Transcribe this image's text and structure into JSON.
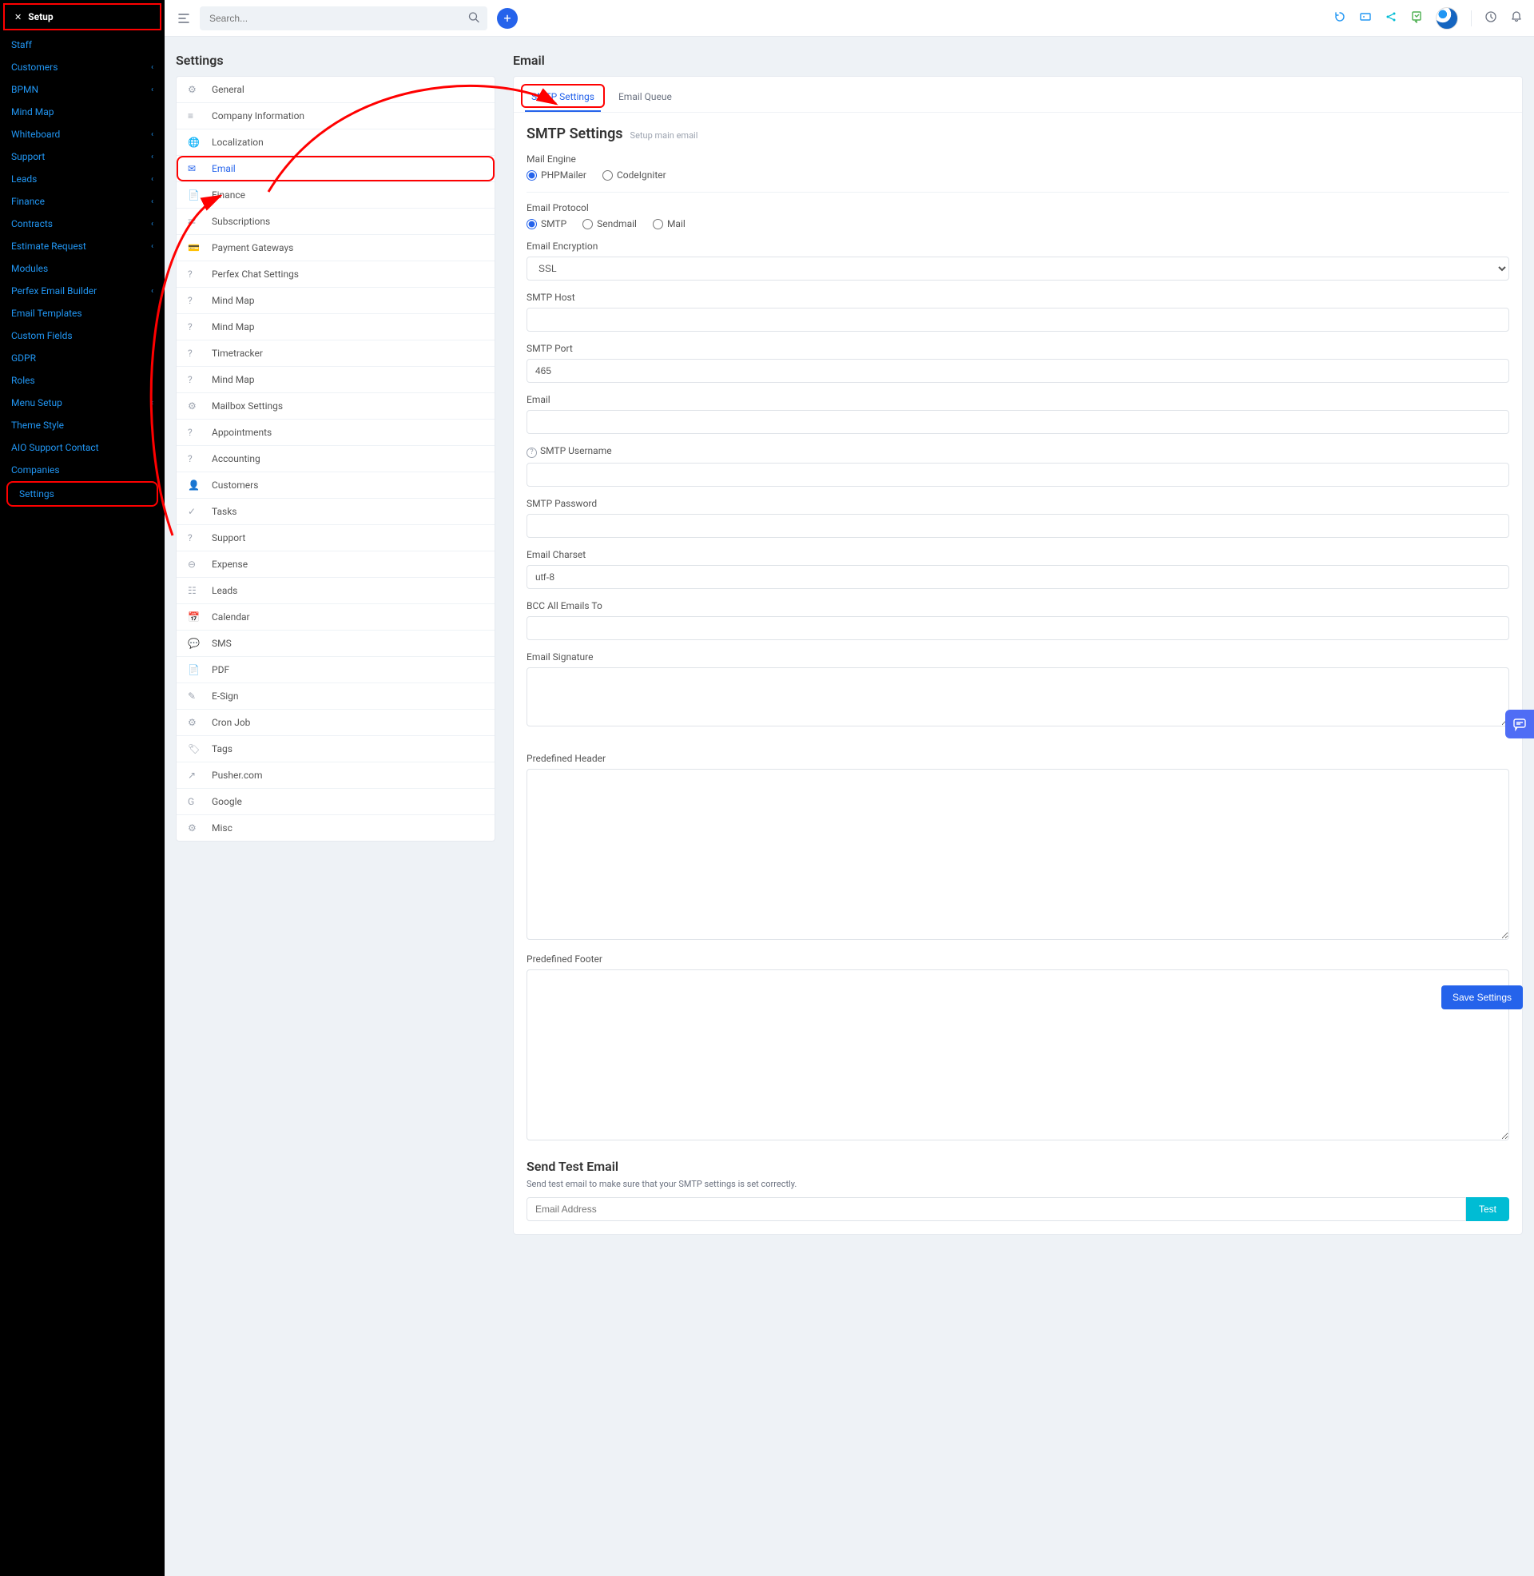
{
  "sidebar": {
    "setup_label": "Setup",
    "items": [
      {
        "label": "Staff",
        "chev": false
      },
      {
        "label": "Customers",
        "chev": true
      },
      {
        "label": "BPMN",
        "chev": true
      },
      {
        "label": "Mind Map",
        "chev": false
      },
      {
        "label": "Whiteboard",
        "chev": true
      },
      {
        "label": "Support",
        "chev": true
      },
      {
        "label": "Leads",
        "chev": true
      },
      {
        "label": "Finance",
        "chev": true
      },
      {
        "label": "Contracts",
        "chev": true
      },
      {
        "label": "Estimate Request",
        "chev": true
      },
      {
        "label": "Modules",
        "chev": false
      },
      {
        "label": "Perfex Email Builder",
        "chev": true
      },
      {
        "label": "Email Templates",
        "chev": false
      },
      {
        "label": "Custom Fields",
        "chev": false
      },
      {
        "label": "GDPR",
        "chev": false
      },
      {
        "label": "Roles",
        "chev": false
      },
      {
        "label": "Menu Setup",
        "chev": true
      },
      {
        "label": "Theme Style",
        "chev": false
      },
      {
        "label": "AIO Support Contact",
        "chev": false
      },
      {
        "label": "Companies",
        "chev": false
      },
      {
        "label": "Settings",
        "chev": false,
        "highlight": true
      }
    ]
  },
  "topbar": {
    "search_placeholder": "Search..."
  },
  "settings": {
    "title": "Settings",
    "items": [
      {
        "icon": "⚙",
        "label": "General"
      },
      {
        "icon": "≡",
        "label": "Company Information"
      },
      {
        "icon": "🌐",
        "label": "Localization"
      },
      {
        "icon": "✉",
        "label": "Email",
        "active": true,
        "highlighted": true
      },
      {
        "icon": "📄",
        "label": "Finance"
      },
      {
        "icon": "⇄",
        "label": "Subscriptions"
      },
      {
        "icon": "💳",
        "label": "Payment Gateways"
      },
      {
        "icon": "?",
        "label": "Perfex Chat Settings"
      },
      {
        "icon": "?",
        "label": "Mind Map"
      },
      {
        "icon": "?",
        "label": "Mind Map"
      },
      {
        "icon": "?",
        "label": "Timetracker"
      },
      {
        "icon": "?",
        "label": "Mind Map"
      },
      {
        "icon": "⚙",
        "label": "Mailbox Settings"
      },
      {
        "icon": "?",
        "label": "Appointments"
      },
      {
        "icon": "?",
        "label": "Accounting"
      },
      {
        "icon": "👤",
        "label": "Customers"
      },
      {
        "icon": "✓",
        "label": "Tasks"
      },
      {
        "icon": "?",
        "label": "Support"
      },
      {
        "icon": "⊖",
        "label": "Expense"
      },
      {
        "icon": "☷",
        "label": "Leads"
      },
      {
        "icon": "📅",
        "label": "Calendar"
      },
      {
        "icon": "💬",
        "label": "SMS"
      },
      {
        "icon": "📄",
        "label": "PDF"
      },
      {
        "icon": "✎",
        "label": "E-Sign"
      },
      {
        "icon": "⚙",
        "label": "Cron Job"
      },
      {
        "icon": "🏷",
        "label": "Tags"
      },
      {
        "icon": "↗",
        "label": "Pusher.com"
      },
      {
        "icon": "G",
        "label": "Google"
      },
      {
        "icon": "⚙",
        "label": "Misc"
      }
    ]
  },
  "email": {
    "title": "Email",
    "tabs": [
      {
        "label": "SMTP Settings",
        "active": true
      },
      {
        "label": "Email Queue"
      }
    ],
    "section_title": "SMTP Settings",
    "section_sub": "Setup main email",
    "fields": {
      "mail_engine_label": "Mail Engine",
      "mail_engine_options": [
        "PHPMailer",
        "CodeIgniter"
      ],
      "mail_engine_value": "PHPMailer",
      "email_protocol_label": "Email Protocol",
      "email_protocol_options": [
        "SMTP",
        "Sendmail",
        "Mail"
      ],
      "email_protocol_value": "SMTP",
      "email_encryption_label": "Email Encryption",
      "email_encryption_value": "SSL",
      "smtp_host_label": "SMTP Host",
      "smtp_host_value": "",
      "smtp_port_label": "SMTP Port",
      "smtp_port_value": "465",
      "email_label": "Email",
      "email_value": "",
      "smtp_username_label": "SMTP Username",
      "smtp_username_value": "",
      "smtp_password_label": "SMTP Password",
      "smtp_password_value": "",
      "email_charset_label": "Email Charset",
      "email_charset_value": "utf-8",
      "bcc_label": "BCC All Emails To",
      "bcc_value": "",
      "signature_label": "Email Signature",
      "signature_value": "",
      "predef_header_label": "Predefined Header",
      "predef_header_value": "",
      "predef_footer_label": "Predefined Footer",
      "predef_footer_value": "",
      "save_btn": "Save Settings",
      "test_title": "Send Test Email",
      "test_sub": "Send test email to make sure that your SMTP settings is set correctly.",
      "test_placeholder": "Email Address",
      "test_btn": "Test"
    }
  }
}
